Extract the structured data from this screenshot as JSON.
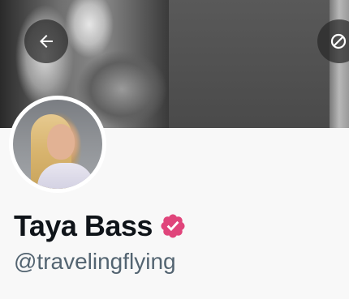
{
  "profile": {
    "display_name": "Taya Bass",
    "handle": "@travelingflying",
    "verified": true
  },
  "icons": {
    "back": "arrow-left-icon",
    "more": "more-options-icon",
    "verified": "verified-badge-icon"
  },
  "colors": {
    "verified_badge": "#e0457b",
    "name_text": "#0f1419",
    "handle_text": "#536471",
    "overlay_button": "#282828"
  }
}
